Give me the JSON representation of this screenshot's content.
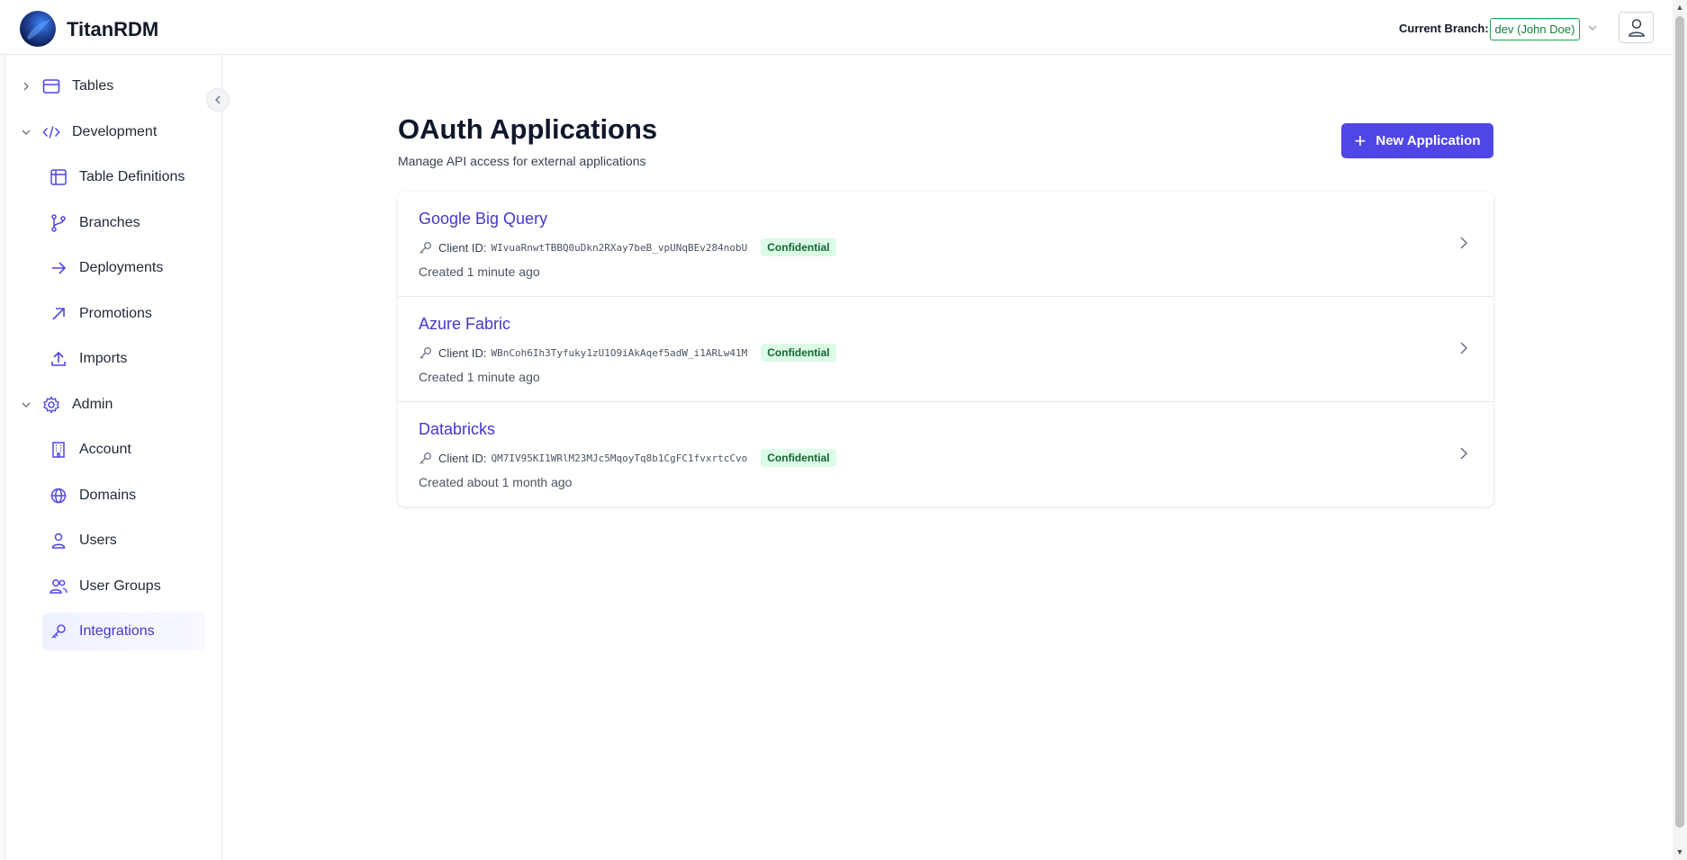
{
  "app": {
    "name": "TitanRDM"
  },
  "header": {
    "branch_label": "Current Branch:",
    "branch_value": "dev (John Doe)"
  },
  "sidebar": {
    "items": [
      {
        "label": "Tables",
        "icon": "table-icon",
        "expandable": true,
        "expanded": false
      },
      {
        "label": "Development",
        "icon": "code-icon",
        "expandable": true,
        "expanded": true
      },
      {
        "label": "Table Definitions",
        "icon": "table-definitions-icon"
      },
      {
        "label": "Branches",
        "icon": "git-branch-icon"
      },
      {
        "label": "Deployments",
        "icon": "arrow-right-icon"
      },
      {
        "label": "Promotions",
        "icon": "arrow-up-right-icon"
      },
      {
        "label": "Imports",
        "icon": "upload-icon"
      },
      {
        "label": "Admin",
        "icon": "gear-icon",
        "expandable": true,
        "expanded": true
      },
      {
        "label": "Account",
        "icon": "building-icon"
      },
      {
        "label": "Domains",
        "icon": "globe-icon"
      },
      {
        "label": "Users",
        "icon": "user-icon"
      },
      {
        "label": "User Groups",
        "icon": "users-icon"
      },
      {
        "label": "Integrations",
        "icon": "key-icon",
        "active": true
      }
    ]
  },
  "main": {
    "title": "OAuth Applications",
    "subtitle": "Manage API access for external applications",
    "new_button_label": "New Application",
    "client_id_label": "Client ID:",
    "applications": [
      {
        "name": "Google Big Query",
        "client_id": "WIvuaRnwtTBBQ0uDkn2RXay7beB_vpUNqBEv284nobU",
        "badge": "Confidential",
        "created": "Created 1 minute ago"
      },
      {
        "name": "Azure Fabric",
        "client_id": "WBnCoh6Ih3Tyfuky1zU1O9iAkAqef5adW_i1ARLw41M",
        "badge": "Confidential",
        "created": "Created 1 minute ago"
      },
      {
        "name": "Databricks",
        "client_id": "QM7IV95KI1WRlM23MJc5MqoyTq8b1CgFC1fvxrtcCvo",
        "badge": "Confidential",
        "created": "Created about 1 month ago"
      }
    ]
  },
  "colors": {
    "accent": "#4f46e5",
    "link": "#4338ca",
    "badge_bg": "#dcfce7",
    "badge_text": "#166534",
    "branch_border": "#16a34a"
  }
}
